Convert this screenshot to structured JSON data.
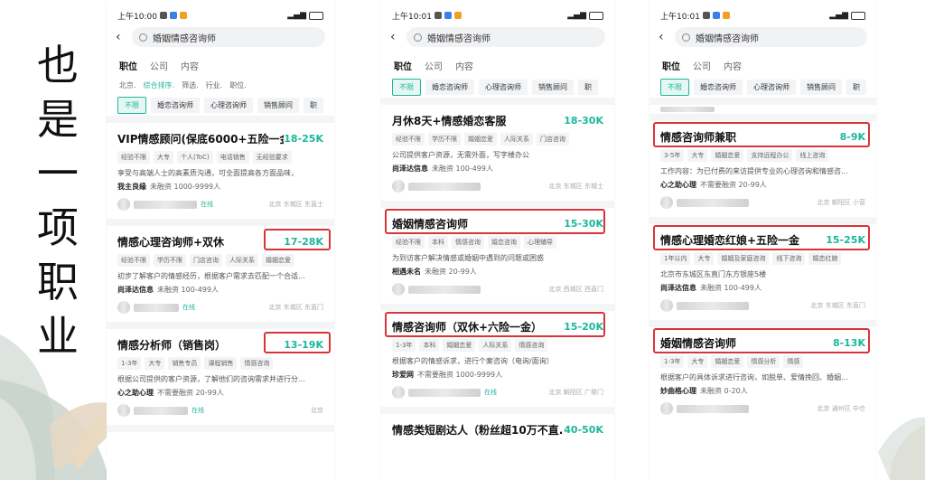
{
  "side_title": [
    "也",
    "是",
    "一",
    "项",
    "职",
    "业"
  ],
  "colors": {
    "accent": "#1db79c",
    "highlight": "#d9343a"
  },
  "phones": [
    {
      "time": "上午10:00",
      "search": "婚姻情感咨询师",
      "tabs": [
        "职位",
        "公司",
        "内容"
      ],
      "filters": [
        "北京.",
        "综合排序.",
        "筛选.",
        "行业.",
        "职位."
      ],
      "chips": [
        "不限",
        "婚恋咨询师",
        "心理咨询师",
        "销售顾问",
        "职"
      ],
      "cards": [
        {
          "title": "VIP情感顾问(保底6000+五险一金)",
          "salary": "18-25K",
          "tags": [
            "经验不限",
            "大专",
            "个人(ToC)",
            "电话销售",
            "无经验要求"
          ],
          "desc": "享受与高端人士的高素质沟通，可全面提高各方面品味，",
          "company": "我主良缘",
          "stage": "未融资 1000-9999人",
          "online": "在线",
          "loc": "北京 东城区 东直士"
        },
        {
          "title": "情感心理咨询师+双休",
          "salary": "17-28K",
          "tags": [
            "经验不限",
            "学历不限",
            "门店咨询",
            "人际关系",
            "婚姻恋爱"
          ],
          "desc": "初步了解客户的情感经历，根据客户需求去匹配一个合适...",
          "company": "尚泽达信息",
          "stage": "未融资 100-499人",
          "online": "在线",
          "loc": "北京 东城区 东直门"
        },
        {
          "title": "情感分析师（销售岗）",
          "salary": "13-19K",
          "tags": [
            "1-3年",
            "大专",
            "销售专员",
            "课程销售",
            "情感咨询"
          ],
          "desc": "根据公司提供的客户资源，了解他们的咨询需求并进行分...",
          "company": "心之助心理",
          "stage": "不需要融资 20-99人",
          "online": "在线",
          "loc": "北京"
        }
      ]
    },
    {
      "time": "上午10:01",
      "search": "婚姻情感咨询师",
      "tabs": [
        "职位",
        "公司",
        "内容"
      ],
      "chips": [
        "不限",
        "婚恋咨询师",
        "心理咨询师",
        "销售顾问",
        "职"
      ],
      "cards": [
        {
          "title": "月休8天+情感婚恋客服",
          "salary": "18-30K",
          "tags": [
            "经验不限",
            "学历不限",
            "婚姻恋爱",
            "人际关系",
            "门店咨询"
          ],
          "desc": "公司提供客户资源，无需外面，写字楼办公",
          "company": "尚泽达信息",
          "stage": "未融资 100-499人",
          "loc": "北京 东城区 东城士"
        },
        {
          "title": "婚姻情感咨询师",
          "salary": "15-30K",
          "tags": [
            "经验不限",
            "本科",
            "情感咨询",
            "婚恋咨询",
            "心理辅导"
          ],
          "desc": "为到访客户解决情感或婚姻中遇到的问题或困惑",
          "company": "相遇未名",
          "stage": "未融资 20-99人",
          "loc": "北京 西城区 西直门"
        },
        {
          "title": "情感咨询师（双休+六险一金）",
          "salary": "15-20K",
          "tags": [
            "1-3年",
            "本科",
            "婚姻恋爱",
            "人际关系",
            "情感咨询"
          ],
          "desc": "根据客户的情感诉求，进行个案咨询（电询/面询）",
          "company": "珍爱网",
          "stage": "不需要融资 1000-9999人",
          "online": "在线",
          "loc": "北京 朝阳区 广渠门"
        },
        {
          "title": "情感类短剧达人（粉丝超10万不直...",
          "salary": "40-50K"
        }
      ]
    },
    {
      "time": "上午10:01",
      "search": "婚姻情感咨询师",
      "tabs": [
        "职位",
        "公司",
        "内容"
      ],
      "chips": [
        "不限",
        "婚恋咨询师",
        "心理咨询师",
        "销售顾问",
        "职"
      ],
      "cards": [
        {
          "title": "情感咨询师兼职",
          "salary": "8-9K",
          "tags": [
            "3-5年",
            "大专",
            "婚姻恋爱",
            "支持远程办公",
            "线上咨询"
          ],
          "desc": "工作内容：为已付费的来访提供专业的心理咨询和情感咨...",
          "company": "心之助心理",
          "stage": "不需要融资 20-99人",
          "loc": "北京 朝阳区 小营"
        },
        {
          "title": "情感心理婚恋红娘+五险一金",
          "salary": "15-25K",
          "tags": [
            "1年以内",
            "大专",
            "婚姻及家庭咨询",
            "线下咨询",
            "婚恋红娘"
          ],
          "desc": "北京市东城区东直门东方银座5楼",
          "company": "尚泽达信息",
          "stage": "未融资 100-499人",
          "loc": "北京 东城区 东直门"
        },
        {
          "title": "婚姻情感咨询师",
          "salary": "8-13K",
          "tags": [
            "1-3年",
            "大专",
            "婚姻恋爱",
            "情感分析",
            "情感"
          ],
          "desc": "根据客户的具体诉求进行咨询，如脱单、爱情挽回、婚姻...",
          "company": "妙曲格心理",
          "stage": "未融资 0-20人",
          "loc": "北京 通州区 中仓"
        }
      ]
    }
  ]
}
